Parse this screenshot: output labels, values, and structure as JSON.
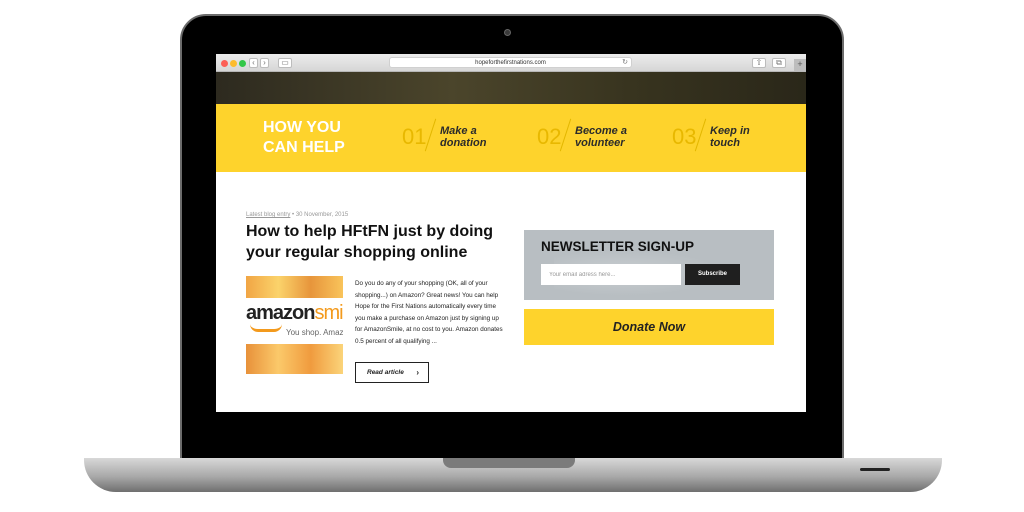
{
  "browser": {
    "url": "hopeforthefirstnations.com",
    "back_icon": "‹",
    "forward_icon": "›"
  },
  "header": {
    "title_line1": "HOW YOU",
    "title_line2": "CAN HELP",
    "steps": [
      {
        "num": "01",
        "label": "Make a donation"
      },
      {
        "num": "02",
        "label": "Become a volunteer"
      },
      {
        "num": "03",
        "label": "Keep in touch"
      }
    ]
  },
  "post": {
    "category": "Latest blog entry",
    "date": "30 November, 2015",
    "title": "How to help HFtFN just by doing your regular shopping online",
    "thumb_brand": "amazon",
    "thumb_brand_suffix": "smi",
    "thumb_tagline": "You shop. Amaz",
    "excerpt": "Do you do any of your shopping (OK, all of your shopping...) on Amazon? Great news! You can help Hope for the First Nations automatically every time you make a purchase on Amazon just by signing up for AmazonSmile, at no cost to you. Amazon donates 0.5 percent of all qualifying ...",
    "read_label": "Read article"
  },
  "newsletter": {
    "title": "NEWSLETTER SIGN-UP",
    "email_placeholder": "Your email adress here...",
    "subscribe_label": "Subscribe"
  },
  "donate": {
    "label": "Donate Now"
  },
  "colors": {
    "accent_yellow": "#fed32c",
    "newsletter_bg": "#b8bec2"
  }
}
